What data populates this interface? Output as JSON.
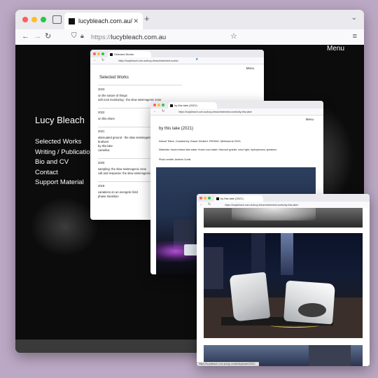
{
  "main_browser": {
    "tab_title": "lucybleach.com.au/",
    "url_scheme": "https://",
    "url_host": "lucybleach.com.au",
    "icons": [
      "sidebar-icon",
      "close-icon",
      "new-tab-plus-icon",
      "chevron-down-icon",
      "back-arrow-icon",
      "forward-arrow-icon",
      "reload-icon",
      "shield-icon",
      "lock-icon",
      "star-icon",
      "hamburger-menu-icon"
    ],
    "site": {
      "menu_label": "Menu",
      "site_title": "Lucy Bleach",
      "nav": [
        "Selected Works",
        "Writing / Publications",
        "Bio and CV",
        "Contact",
        "Support Material"
      ]
    }
  },
  "works_browser": {
    "tab_title": "Selected Works",
    "url": "https://lucybleach.com.au/lucy-bleach/selected-works/",
    "menu_label": "Menu",
    "heading": "Selected Works",
    "groups": [
      {
        "year": "2023",
        "items": [
          "on the nature of things",
          "soft rock monitoring - the slow seismogenic zone"
        ]
      },
      {
        "year": "2022",
        "items": [
          "on this shore"
        ]
      },
      {
        "year": "2021",
        "items": [
          "attenuated ground - the slow seismogenic zone",
          "brothers",
          "by this lake",
          "camellus"
        ]
      },
      {
        "year": "2020",
        "items": [
          "sampling: the slow seismogenic zone",
          "call and response: the slow seismogenic zone"
        ]
      },
      {
        "year": "2018",
        "items": [
          "variations on an energetic field",
          "phase transition"
        ]
      }
    ]
  },
  "lake_browser": {
    "tab_title": "by this lake (2021)",
    "url": "https://lucybleach.com.au/lucy-bleach/selected-works/by-this-lake/",
    "menu_label": "Menu",
    "heading": "by this lake (2021)",
    "line1": "Inland Tides. Curated by Grace Herbert. RISING. Melbourne 2021",
    "line2": "Materials: frozen inland lake water, frozen cool water, Harcourt granite, neon light, hydrophones, speakers",
    "line3": "Photo credits: Andrew Curtis"
  },
  "photo_browser": {
    "tab_title": "by this lake (2021)",
    "url": "https://lucybleach.com.au/lucy-bleach/selected-works/by-this-lake/",
    "status": "https://lucybleach.com.au/wp-content/uploads/2021/..."
  },
  "colors": {
    "background": "#bba8c4",
    "site_bg": "#0c0c0c",
    "traffic_red": "#ff5f57",
    "traffic_yellow": "#febc2e",
    "traffic_green": "#28c840"
  }
}
